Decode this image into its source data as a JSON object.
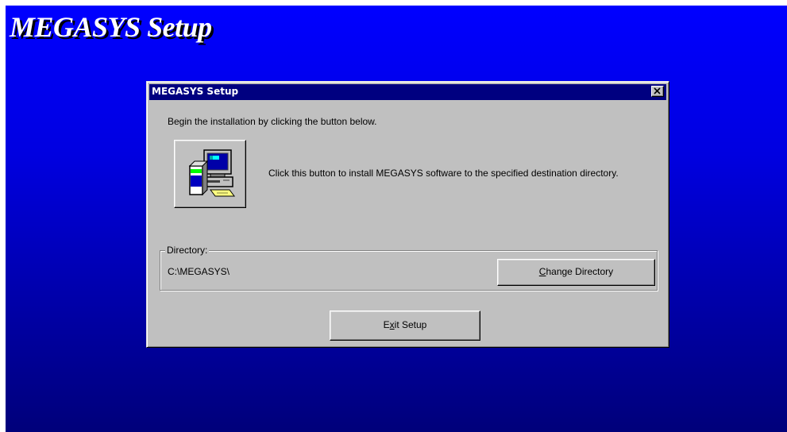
{
  "banner": {
    "title": "MEGASYS Setup"
  },
  "dialog": {
    "title": "MEGASYS Setup",
    "close_symbol": "✕",
    "intro": "Begin the installation by clicking the button below.",
    "install_description": "Click this button to install MEGASYS software to the specified destination directory.",
    "directory": {
      "label": "Directory:",
      "path": "C:\\MEGASYS\\",
      "change_button": {
        "mnemonic": "C",
        "rest": "hange Directory"
      }
    },
    "exit_button": {
      "before": "E",
      "mnemonic": "x",
      "rest": "it Setup"
    }
  },
  "icons": {
    "install": "computer-install-icon",
    "close": "close-icon"
  },
  "colors": {
    "desktop_top": "#0000ff",
    "desktop_bottom": "#00007a",
    "titlebar": "#000080",
    "dialog_face": "#c0c0c0"
  }
}
